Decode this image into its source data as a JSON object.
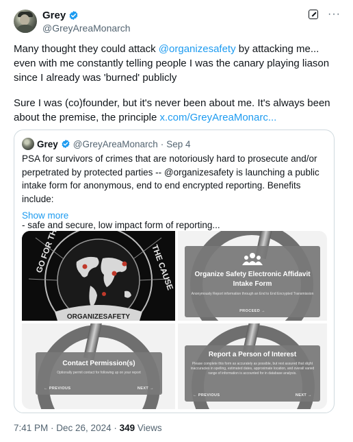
{
  "author": {
    "name": "Grey",
    "handle": "@GreyAreaMonarch",
    "avatar_icon": "avatar-photo"
  },
  "top_actions": {
    "grok_icon": "grok-icon",
    "more": "···"
  },
  "tweet": {
    "para1_prefix": "Many thought they could attack ",
    "para1_mention": "@organizesafety",
    "para1_suffix": " by attacking me... even with me constantly telling people I was the canary playing liason since I already was 'burned' publicly",
    "para2_prefix": "Sure I was (co)founder, but it's never been about me. It's always been about the premise, the principle ",
    "para2_link": "x.com/GreyAreaMonarc..."
  },
  "quote": {
    "name": "Grey",
    "handle": "@GreyAreaMonarch",
    "dot": "·",
    "date": "Sep 4",
    "text": "PSA for survivors of crimes that are notoriously hard to prosecute and/or perpetrated by protected parties -- @organizesafety is launching a public intake form for anonymous, end to end encrypted reporting. Benefits include:",
    "text2": "- safe and secure, low impact form of reporting...",
    "show_more": "Show more",
    "media": {
      "logo_text_left": "GO FOR THE",
      "logo_text_right": "THE CAUSE",
      "logo_banner": "ORGANIZESAFETY",
      "panel1": {
        "title": "Organize Safety Electronic Affidavit Intake Form",
        "subtitle": "Anonymously Report information through an End to End Encrypted Transmission",
        "nav_next": "PROCEED →"
      },
      "panel2": {
        "title": "Contact Permission(s)",
        "subtitle": "Optionally permit contact for following up on your report",
        "nav_prev": "← PREVIOUS",
        "nav_next": "NEXT →"
      },
      "panel3": {
        "title": "Report a Person of Interest",
        "subtitle": "Please complete this form as accurately as possible, but rest assured that slight inaccuracies in spelling, estimated dates, approximate location, and overall varied range of information is accounted for in database analysis.",
        "nav_prev": "← PREVIOUS",
        "nav_next": "NEXT →"
      }
    }
  },
  "footer": {
    "time": "7:41 PM",
    "sep1": " · ",
    "date": "Dec 26, 2024",
    "sep2": " · ",
    "views_count": "349",
    "views_label": " Views"
  },
  "colors": {
    "link": "#1d9bf0",
    "verified": "#1d9bf0",
    "muted": "#536471"
  }
}
